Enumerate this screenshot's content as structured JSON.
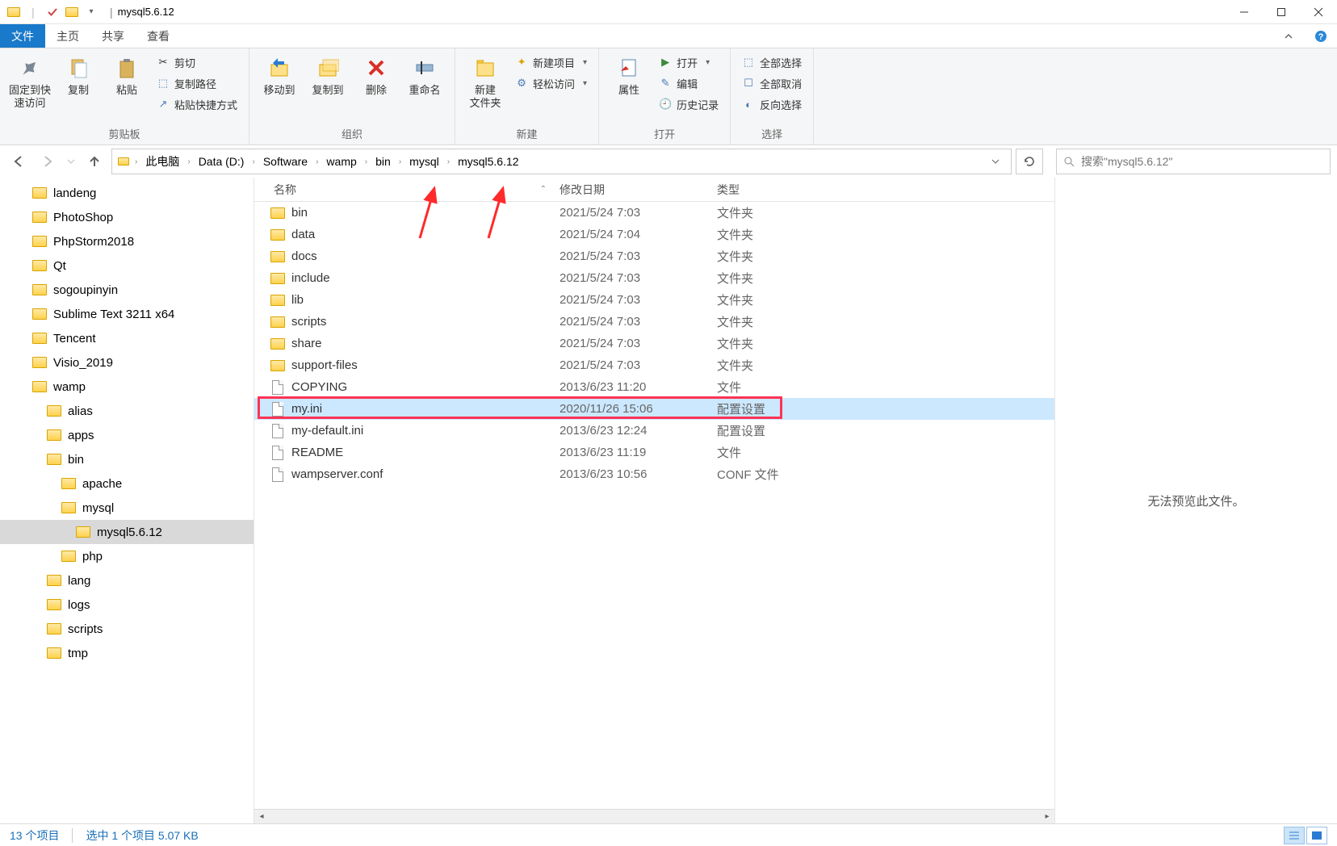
{
  "window": {
    "title": "mysql5.6.12"
  },
  "ribbon_tabs": {
    "file": "文件",
    "home": "主页",
    "share": "共享",
    "view": "查看"
  },
  "ribbon": {
    "clipboard": {
      "pin": "固定到快\n速访问",
      "copy": "复制",
      "paste": "粘贴",
      "cut": "剪切",
      "copypath": "复制路径",
      "paste_shortcut": "粘贴快捷方式",
      "label": "剪贴板"
    },
    "organize": {
      "moveto": "移动到",
      "copyto": "复制到",
      "delete": "删除",
      "rename": "重命名",
      "label": "组织"
    },
    "new": {
      "newfolder": "新建\n文件夹",
      "newitem": "新建项目",
      "easyaccess": "轻松访问",
      "label": "新建"
    },
    "open": {
      "properties": "属性",
      "open": "打开",
      "edit": "编辑",
      "history": "历史记录",
      "label": "打开"
    },
    "select": {
      "all": "全部选择",
      "none": "全部取消",
      "invert": "反向选择",
      "label": "选择"
    }
  },
  "breadcrumb": [
    "此电脑",
    "Data (D:)",
    "Software",
    "wamp",
    "bin",
    "mysql",
    "mysql5.6.12"
  ],
  "search": {
    "placeholder": "搜索\"mysql5.6.12\""
  },
  "columns": {
    "name": "名称",
    "modified": "修改日期",
    "type": "类型"
  },
  "tree": [
    {
      "label": "landeng",
      "depth": 0
    },
    {
      "label": "PhotoShop",
      "depth": 0
    },
    {
      "label": "PhpStorm2018",
      "depth": 0
    },
    {
      "label": "Qt",
      "depth": 0
    },
    {
      "label": "sogoupinyin",
      "depth": 0
    },
    {
      "label": "Sublime Text 3211 x64",
      "depth": 0
    },
    {
      "label": "Tencent",
      "depth": 0
    },
    {
      "label": "Visio_2019",
      "depth": 0
    },
    {
      "label": "wamp",
      "depth": 0
    },
    {
      "label": "alias",
      "depth": 1
    },
    {
      "label": "apps",
      "depth": 1
    },
    {
      "label": "bin",
      "depth": 1
    },
    {
      "label": "apache",
      "depth": 2
    },
    {
      "label": "mysql",
      "depth": 2
    },
    {
      "label": "mysql5.6.12",
      "depth": 3,
      "selected": true
    },
    {
      "label": "php",
      "depth": 2
    },
    {
      "label": "lang",
      "depth": 1
    },
    {
      "label": "logs",
      "depth": 1
    },
    {
      "label": "scripts",
      "depth": 1
    },
    {
      "label": "tmp",
      "depth": 1
    }
  ],
  "files": [
    {
      "name": "bin",
      "date": "2021/5/24 7:03",
      "type": "文件夹",
      "icon": "folder"
    },
    {
      "name": "data",
      "date": "2021/5/24 7:04",
      "type": "文件夹",
      "icon": "folder"
    },
    {
      "name": "docs",
      "date": "2021/5/24 7:03",
      "type": "文件夹",
      "icon": "folder"
    },
    {
      "name": "include",
      "date": "2021/5/24 7:03",
      "type": "文件夹",
      "icon": "folder"
    },
    {
      "name": "lib",
      "date": "2021/5/24 7:03",
      "type": "文件夹",
      "icon": "folder"
    },
    {
      "name": "scripts",
      "date": "2021/5/24 7:03",
      "type": "文件夹",
      "icon": "folder"
    },
    {
      "name": "share",
      "date": "2021/5/24 7:03",
      "type": "文件夹",
      "icon": "folder"
    },
    {
      "name": "support-files",
      "date": "2021/5/24 7:03",
      "type": "文件夹",
      "icon": "folder"
    },
    {
      "name": "COPYING",
      "date": "2013/6/23 11:20",
      "type": "文件",
      "icon": "file"
    },
    {
      "name": "my.ini",
      "date": "2020/11/26 15:06",
      "type": "配置设置",
      "icon": "file",
      "selected": true,
      "highlighted": true
    },
    {
      "name": "my-default.ini",
      "date": "2013/6/23 12:24",
      "type": "配置设置",
      "icon": "file"
    },
    {
      "name": "README",
      "date": "2013/6/23 11:19",
      "type": "文件",
      "icon": "file"
    },
    {
      "name": "wampserver.conf",
      "date": "2013/6/23 10:56",
      "type": "CONF 文件",
      "icon": "file"
    }
  ],
  "preview": {
    "message": "无法预览此文件。"
  },
  "status": {
    "count": "13 个项目",
    "selection": "选中 1 个项目  5.07 KB"
  }
}
